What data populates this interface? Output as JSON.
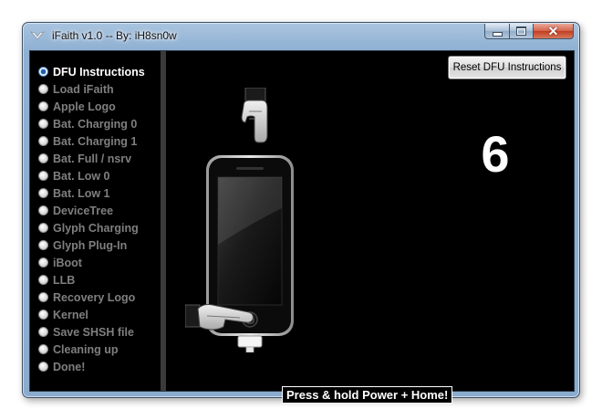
{
  "window": {
    "title": "iFaith v1.0 -- By: iH8sn0w",
    "controls": {
      "minimize": "minimize",
      "maximize": "maximize",
      "close": "close"
    }
  },
  "steps": [
    {
      "label": "DFU Instructions",
      "active": true
    },
    {
      "label": "Load iFaith",
      "active": false
    },
    {
      "label": "Apple Logo",
      "active": false
    },
    {
      "label": "Bat. Charging 0",
      "active": false
    },
    {
      "label": "Bat. Charging 1",
      "active": false
    },
    {
      "label": "Bat. Full / nsrv",
      "active": false
    },
    {
      "label": "Bat. Low 0",
      "active": false
    },
    {
      "label": "Bat. Low 1",
      "active": false
    },
    {
      "label": "DeviceTree",
      "active": false
    },
    {
      "label": "Glyph Charging",
      "active": false
    },
    {
      "label": "Glyph Plug-In",
      "active": false
    },
    {
      "label": "iBoot",
      "active": false
    },
    {
      "label": "LLB",
      "active": false
    },
    {
      "label": "Recovery Logo",
      "active": false
    },
    {
      "label": "Kernel",
      "active": false
    },
    {
      "label": "Save SHSH file",
      "active": false
    },
    {
      "label": "Cleaning up",
      "active": false
    },
    {
      "label": "Done!",
      "active": false
    }
  ],
  "main": {
    "reset_button": "Reset DFU Instructions",
    "countdown": "6",
    "instruction": "Press & hold Power + Home!"
  },
  "colors": {
    "background": "#000000",
    "active_text": "#ffffff",
    "inactive_text": "#7f7f7f",
    "window_frame": "#8fb0d2"
  }
}
